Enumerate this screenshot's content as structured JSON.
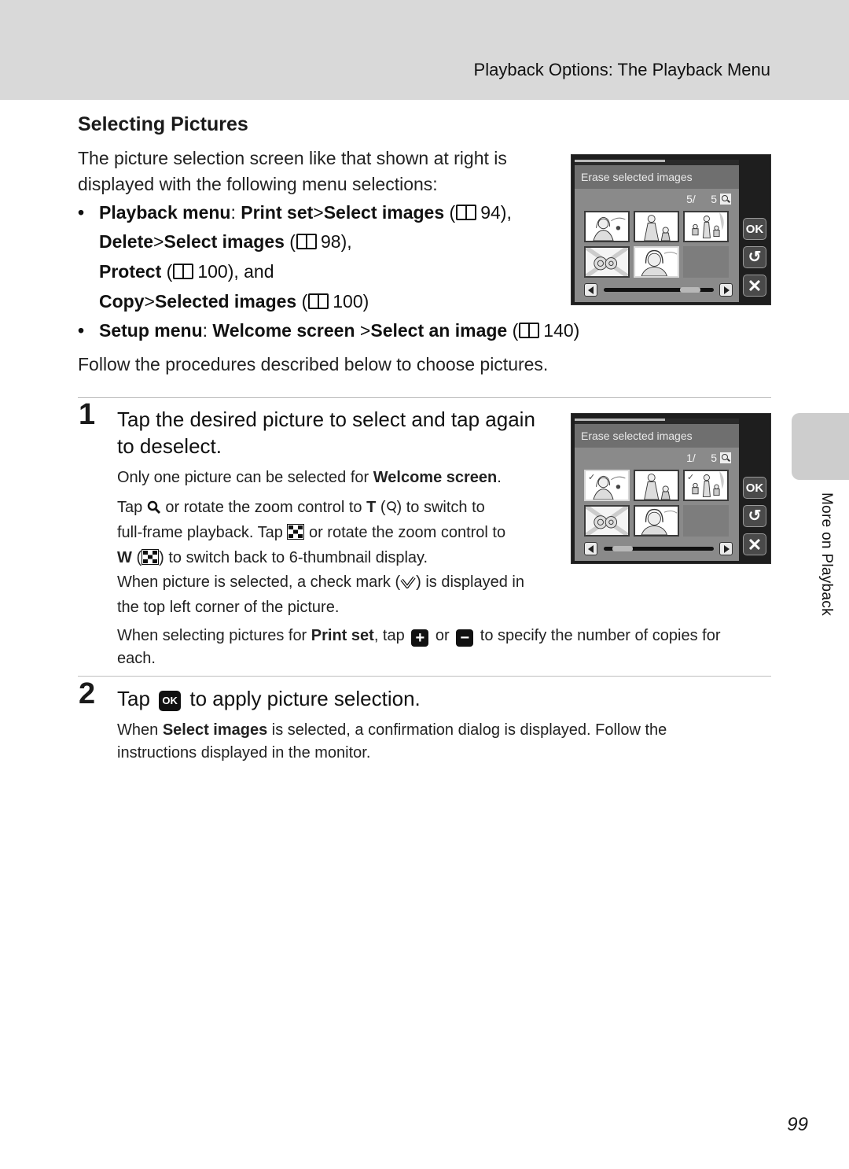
{
  "header": {
    "title": "Playback Options: The Playback Menu"
  },
  "section": {
    "title": "Selecting Pictures",
    "intro": "The picture selection screen like that shown at right is displayed with the following menu selections:",
    "bullets": [
      {
        "lines": [
          {
            "parts": [
              {
                "b": "Playback menu"
              },
              {
                "t": ": "
              },
              {
                "b": "Print set"
              },
              {
                "t": ">"
              },
              {
                "b": "Select images"
              },
              {
                "t": " ("
              },
              {
                "ref": "94"
              },
              {
                "t": "),"
              }
            ]
          },
          {
            "parts": [
              {
                "b": "Delete"
              },
              {
                "t": ">"
              },
              {
                "b": "Select images"
              },
              {
                "t": " ("
              },
              {
                "ref": "98"
              },
              {
                "t": "),"
              }
            ]
          },
          {
            "parts": [
              {
                "b": "Protect"
              },
              {
                "t": " ("
              },
              {
                "ref": "100"
              },
              {
                "t": "), and"
              }
            ]
          },
          {
            "parts": [
              {
                "b": "Copy"
              },
              {
                "t": ">"
              },
              {
                "b": "Selected images"
              },
              {
                "t": " ("
              },
              {
                "ref": "100"
              },
              {
                "t": ")"
              }
            ]
          }
        ]
      },
      {
        "lines": [
          {
            "parts": [
              {
                "b": "Setup menu"
              },
              {
                "t": ": "
              },
              {
                "b": "Welcome screen "
              },
              {
                "t": ">"
              },
              {
                "b": "Select an image"
              },
              {
                "t": " ("
              },
              {
                "ref": "140"
              },
              {
                "t": ")"
              }
            ]
          }
        ]
      }
    ],
    "follow": "Follow the procedures described below to choose pictures."
  },
  "steps": [
    {
      "number": "1",
      "title_line1": "Tap the desired picture to select and tap again",
      "title_line2": "to deselect.",
      "note_welcome_pre": "Only one picture can be selected for ",
      "note_welcome_bold": "Welcome screen",
      "note_welcome_post": ".",
      "zoom_p1_a": "Tap ",
      "zoom_p1_b": " or rotate the zoom control to ",
      "zoom_p1_T": "T",
      "zoom_p1_c": " (",
      "zoom_p1_d": ") to switch to",
      "zoom_p2_a": "full-frame playback. Tap ",
      "zoom_p2_b": " or rotate the zoom control to",
      "zoom_p3_W": "W",
      "zoom_p3_a": " (",
      "zoom_p3_b": ") to switch back to 6-thumbnail display.",
      "check_p1_a": "When picture is selected, a check mark (",
      "check_p1_b": ") is displayed in",
      "check_p2": "the top left corner of the picture.",
      "print_a": "When selecting pictures for ",
      "print_bold": "Print set",
      "print_b": ", tap ",
      "print_c": " or ",
      "print_d": " to specify the number of copies for",
      "print_e": "each."
    },
    {
      "number": "2",
      "title_a": "Tap ",
      "title_b": " to apply picture selection.",
      "ok_glyph": "OK",
      "body_a": "When ",
      "body_bold": "Select images",
      "body_b": " is selected, a confirmation dialog is displayed. Follow the",
      "body_c": "instructions displayed in the monitor."
    }
  ],
  "screens": [
    {
      "title": "Erase selected images",
      "counter_current": "5/",
      "counter_total": "5",
      "scroll_position": 0.85,
      "thumbnails": [
        {
          "subject": "woman-portrait",
          "checked": false
        },
        {
          "subject": "woman-with-child",
          "checked": false
        },
        {
          "subject": "family-outdoors",
          "checked": false
        },
        {
          "subject": "flowers",
          "checked": false
        },
        {
          "subject": "woman-portrait-closeup",
          "checked": false,
          "current": true
        },
        {
          "subject": "empty",
          "checked": false
        }
      ],
      "side_buttons": [
        "OK",
        "↺",
        "✕"
      ]
    },
    {
      "title": "Erase selected images",
      "counter_current": "1/",
      "counter_total": "5",
      "scroll_position": 0.1,
      "thumbnails": [
        {
          "subject": "woman-portrait",
          "checked": true,
          "current": true
        },
        {
          "subject": "woman-with-child",
          "checked": false
        },
        {
          "subject": "family-outdoors",
          "checked": true
        },
        {
          "subject": "flowers",
          "checked": false
        },
        {
          "subject": "woman-portrait-closeup",
          "checked": false
        },
        {
          "subject": "empty",
          "checked": false
        }
      ],
      "side_buttons": [
        "OK",
        "↺",
        "✕"
      ]
    }
  ],
  "side_tab": {
    "label": "More on Playback"
  },
  "page_number": "99",
  "icons": {
    "book": "book-reference-icon",
    "zoom_in": "magnifier-icon",
    "thumbnail": "thumbnail-grid-icon",
    "check": "check-mark-icon",
    "plus": "plus-icon",
    "minus": "minus-icon",
    "ok": "ok-icon"
  },
  "colors": {
    "header_band": "#d9d9d9",
    "side_tab": "#cdcdcd",
    "screen_bg": "#8a8a8a",
    "screen_frame": "#1e1e1e"
  }
}
